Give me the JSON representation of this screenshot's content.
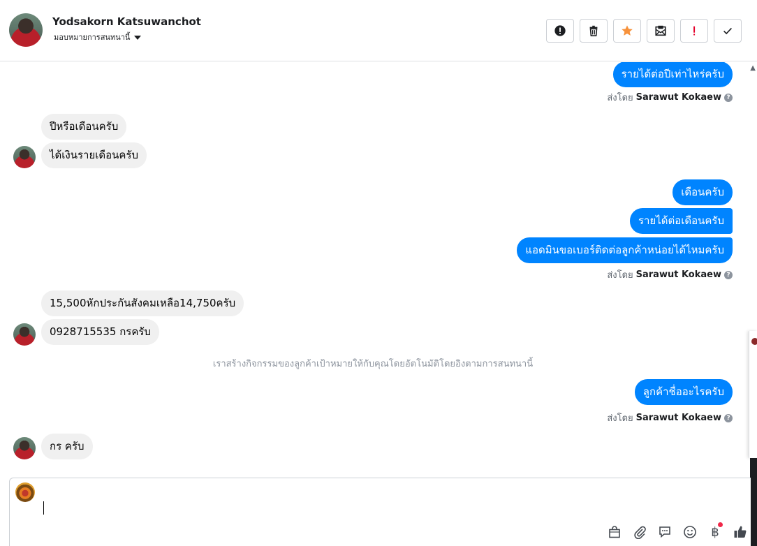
{
  "header": {
    "name": "Yodsakorn Katsuwanchot",
    "subtitle": "มอบหมายการสนทนานี้",
    "actions": [
      {
        "name": "spam-button",
        "icon": "alert-circle-icon"
      },
      {
        "name": "delete-button",
        "icon": "trash-icon"
      },
      {
        "name": "star-button",
        "icon": "star-icon",
        "color": "#f7923b"
      },
      {
        "name": "mark-unread-button",
        "icon": "envelope-icon"
      },
      {
        "name": "important-button",
        "icon": "exclamation-icon",
        "color": "#e4002b"
      },
      {
        "name": "done-button",
        "icon": "check-icon"
      }
    ]
  },
  "messages": {
    "m1": "รายได้ต่อปีเท่าไหร่ครับ",
    "m2": "ปีหรือเดือนครับ",
    "m3": "ได้เงินรายเดือนครับ",
    "m4": "เดือนครับ",
    "m5": "รายได้ต่อเดือนครับ",
    "m6": "แอดมินขอเบอร์ติดต่อลูกค้าหน่อยได้ไหมครับ",
    "m7": "15,500หักประกันสังคมเหลือ14,750ครับ",
    "m8": "0928715535 กรครับ",
    "m9": "ลูกค้าชื่ออะไรครับ",
    "m10": "กร ครับ"
  },
  "sent_by": {
    "prefix": "ส่งโดย",
    "agent": "Sarawut Kokaew",
    "help": "?"
  },
  "activity_note": "เราสร้างกิจกรรมของลูกค้าเป้าหมายให้กับคุณโดยอัตโนมัติโดยอิงตามการสนทนานี้",
  "composer": {
    "value": "",
    "tools": [
      "shopping-bag-icon",
      "paperclip-icon",
      "saved-reply-icon",
      "emoji-icon",
      "baht-icon",
      "like-icon"
    ],
    "baht_symbol": "฿"
  },
  "colors": {
    "outgoing_bubble": "#0084ff",
    "incoming_bubble": "#f0f0f0"
  }
}
